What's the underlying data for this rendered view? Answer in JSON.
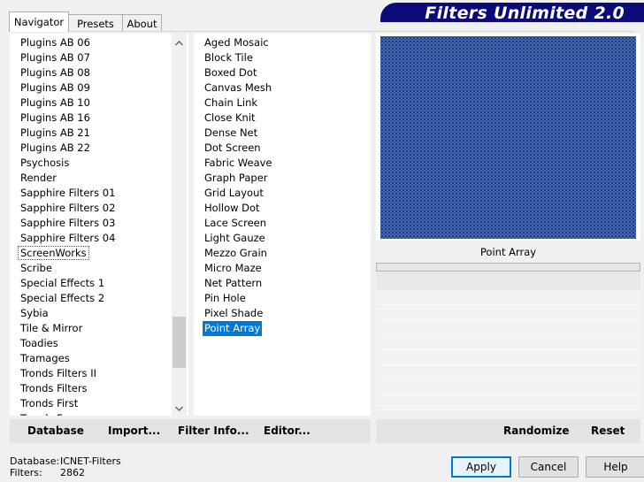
{
  "tabs": [
    "Navigator",
    "Presets",
    "About"
  ],
  "banner_title": "Filters Unlimited 2.0",
  "categories": [
    "Plugins AB 06",
    "Plugins AB 07",
    "Plugins AB 08",
    "Plugins AB 09",
    "Plugins AB 10",
    "Plugins AB 16",
    "Plugins AB 21",
    "Plugins AB 22",
    "Psychosis",
    "Render",
    "Sapphire Filters 01",
    "Sapphire Filters 02",
    "Sapphire Filters 03",
    "Sapphire Filters 04",
    "ScreenWorks",
    "Scribe",
    "Special Effects 1",
    "Special Effects 2",
    "Sybia",
    "Tile & Mirror",
    "Toadies",
    "Tramages",
    "Tronds Filters II",
    "Tronds Filters",
    "Tronds First",
    "Tronds Fun"
  ],
  "focused_category": "ScreenWorks",
  "filters": [
    "Aged Mosaic",
    "Block Tile",
    "Boxed Dot",
    "Canvas Mesh",
    "Chain Link",
    "Close Knit",
    "Dense Net",
    "Dot Screen",
    "Fabric Weave",
    "Graph Paper",
    "Grid Layout",
    "Hollow Dot",
    "Lace Screen",
    "Light Gauze",
    "Mezzo Grain",
    "Micro Maze",
    "Net Pattern",
    "Pin Hole",
    "Pixel Shade",
    "Point Array"
  ],
  "selected_filter": "Point Array",
  "preview": {
    "filter_name": "Point Array"
  },
  "toolbar": {
    "database": "Database",
    "import": "Import...",
    "filter_info": "Filter Info...",
    "editor": "Editor...",
    "randomize": "Randomize",
    "reset": "Reset"
  },
  "status": {
    "database_label": "Database:",
    "database_value": "ICNET-Filters",
    "filters_label": "Filters:",
    "filters_value": "2862"
  },
  "buttons": {
    "apply": "Apply",
    "cancel": "Cancel",
    "help": "Help"
  },
  "colors": {
    "banner": "#0b0b7a",
    "selection": "#0078d7",
    "preview": "#4169b8"
  },
  "icons": {
    "scroll_up": "chevron-up-icon",
    "scroll_down": "chevron-down-icon"
  }
}
